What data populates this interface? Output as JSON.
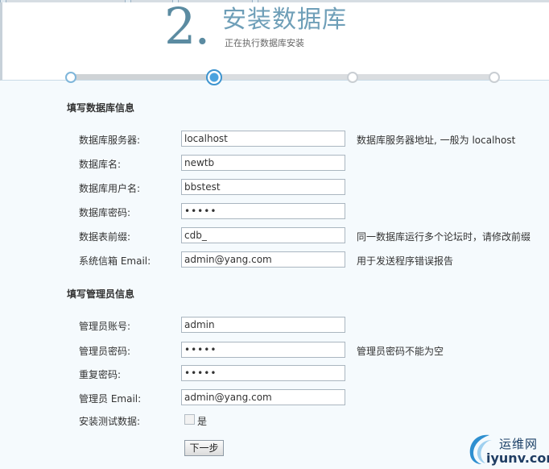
{
  "header": {
    "step_number": "2.",
    "title": "安装数据库",
    "subtitle": "正在执行数据库安装"
  },
  "progress": {
    "steps_total": 4,
    "current_step": 2
  },
  "db_section": {
    "title": "填写数据库信息",
    "fields": {
      "server": {
        "label": "数据库服务器:",
        "value": "localhost",
        "hint": "数据库服务器地址, 一般为 localhost"
      },
      "name": {
        "label": "数据库名:",
        "value": "newtb"
      },
      "user": {
        "label": "数据库用户名:",
        "value": "bbstest"
      },
      "password": {
        "label": "数据库密码:",
        "value": "•••••"
      },
      "prefix": {
        "label": "数据表前缀:",
        "value": "cdb_",
        "hint": "同一数据库运行多个论坛时，请修改前缀"
      },
      "email": {
        "label": "系统信箱 Email:",
        "value": "admin@yang.com",
        "hint": "用于发送程序错误报告"
      }
    }
  },
  "admin_section": {
    "title": "填写管理员信息",
    "fields": {
      "account": {
        "label": "管理员账号:",
        "value": "admin"
      },
      "password": {
        "label": "管理员密码:",
        "value": "•••••",
        "hint": "管理员密码不能为空"
      },
      "repeat": {
        "label": "重复密码:",
        "value": "•••••"
      },
      "email": {
        "label": "管理员 Email:",
        "value": "admin@yang.com"
      },
      "test_data": {
        "label": "安装测试数据:",
        "checkbox_label": "是",
        "checked": false
      }
    }
  },
  "next_button": "下一步",
  "watermark": {
    "cn": "运维网",
    "en": "iyunv.com"
  },
  "colors": {
    "accent": "#3e94cf",
    "title": "#6f9fb8",
    "background": "#f5fafd"
  }
}
